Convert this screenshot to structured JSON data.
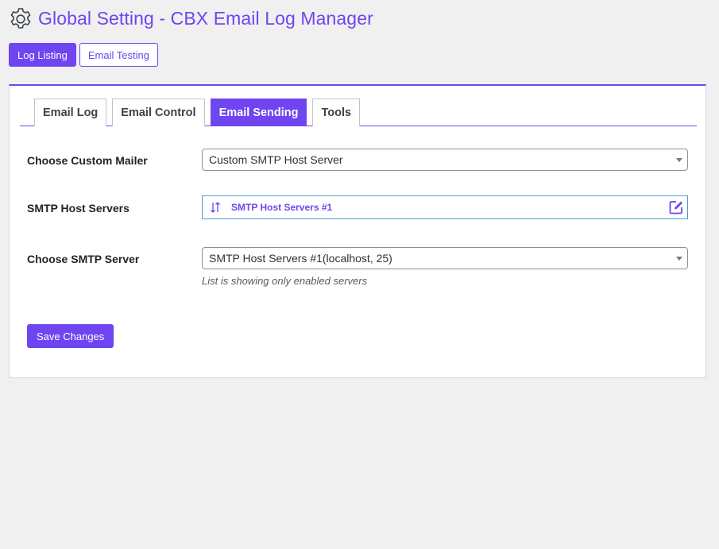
{
  "header": {
    "icon": "gear-icon",
    "title": "Global Setting - CBX Email Log Manager"
  },
  "top_buttons": {
    "log_listing": "Log Listing",
    "email_testing": "Email Testing"
  },
  "tabs": [
    {
      "label": "Email Log",
      "active": false
    },
    {
      "label": "Email Control",
      "active": false
    },
    {
      "label": "Email Sending",
      "active": true
    },
    {
      "label": "Tools",
      "active": false
    }
  ],
  "form": {
    "custom_mailer": {
      "label": "Choose Custom Mailer",
      "value": "Custom SMTP Host Server"
    },
    "smtp_host_servers": {
      "label": "SMTP Host Servers",
      "item": "SMTP Host Servers #1",
      "sort_icon": "sort-arrows-icon",
      "edit_icon": "edit-icon"
    },
    "smtp_server": {
      "label": "Choose SMTP Server",
      "value": "SMTP Host Servers #1(localhost, 25)",
      "help": "List is showing only enabled servers"
    },
    "save_label": "Save Changes"
  },
  "colors": {
    "accent": "#6e45f0",
    "page_bg": "#f0f0f1",
    "item_border": "#4d9ad0"
  }
}
